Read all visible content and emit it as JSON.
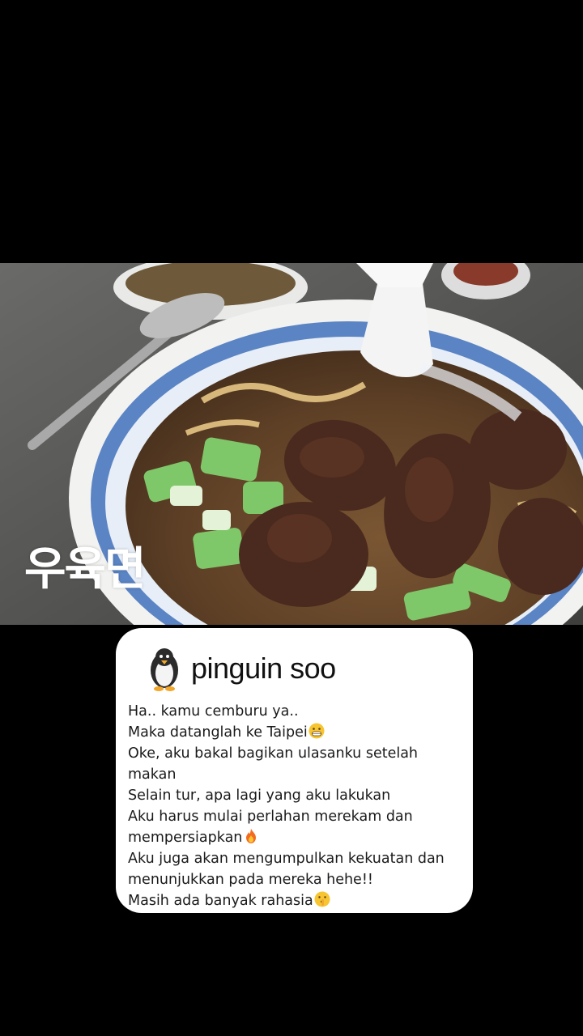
{
  "photo": {
    "overlay_text": "우육면",
    "subject_icon": "beef-noodle-soup-photo"
  },
  "card": {
    "avatar_icon": "penguin-icon",
    "username": "pinguin soo",
    "lines": [
      {
        "text": "Ha.. kamu cemburu ya..",
        "emoji": null
      },
      {
        "text": "Maka datanglah ke Taipei",
        "emoji": "grinning-face-icon"
      },
      {
        "text": "Oke, aku bakal bagikan ulasanku setelah",
        "emoji": null
      },
      {
        "text": "makan",
        "emoji": null
      },
      {
        "text": "Selain tur, apa lagi yang aku lakukan",
        "emoji": null
      },
      {
        "text": "Aku harus mulai perlahan merekam dan",
        "emoji": null
      },
      {
        "text": "mempersiapkan",
        "emoji": "fire-icon"
      },
      {
        "text": "Aku juga akan mengumpulkan kekuatan dan",
        "emoji": null
      },
      {
        "text": "menunjukkan pada mereka hehe!!",
        "emoji": null
      },
      {
        "text": "Masih ada banyak rahasia",
        "emoji": "shushing-face-icon"
      }
    ]
  },
  "colors": {
    "background": "#000000",
    "card": "#ffffff",
    "broth": "#6b4a2b",
    "bowl_rim": "#5b84c4"
  }
}
